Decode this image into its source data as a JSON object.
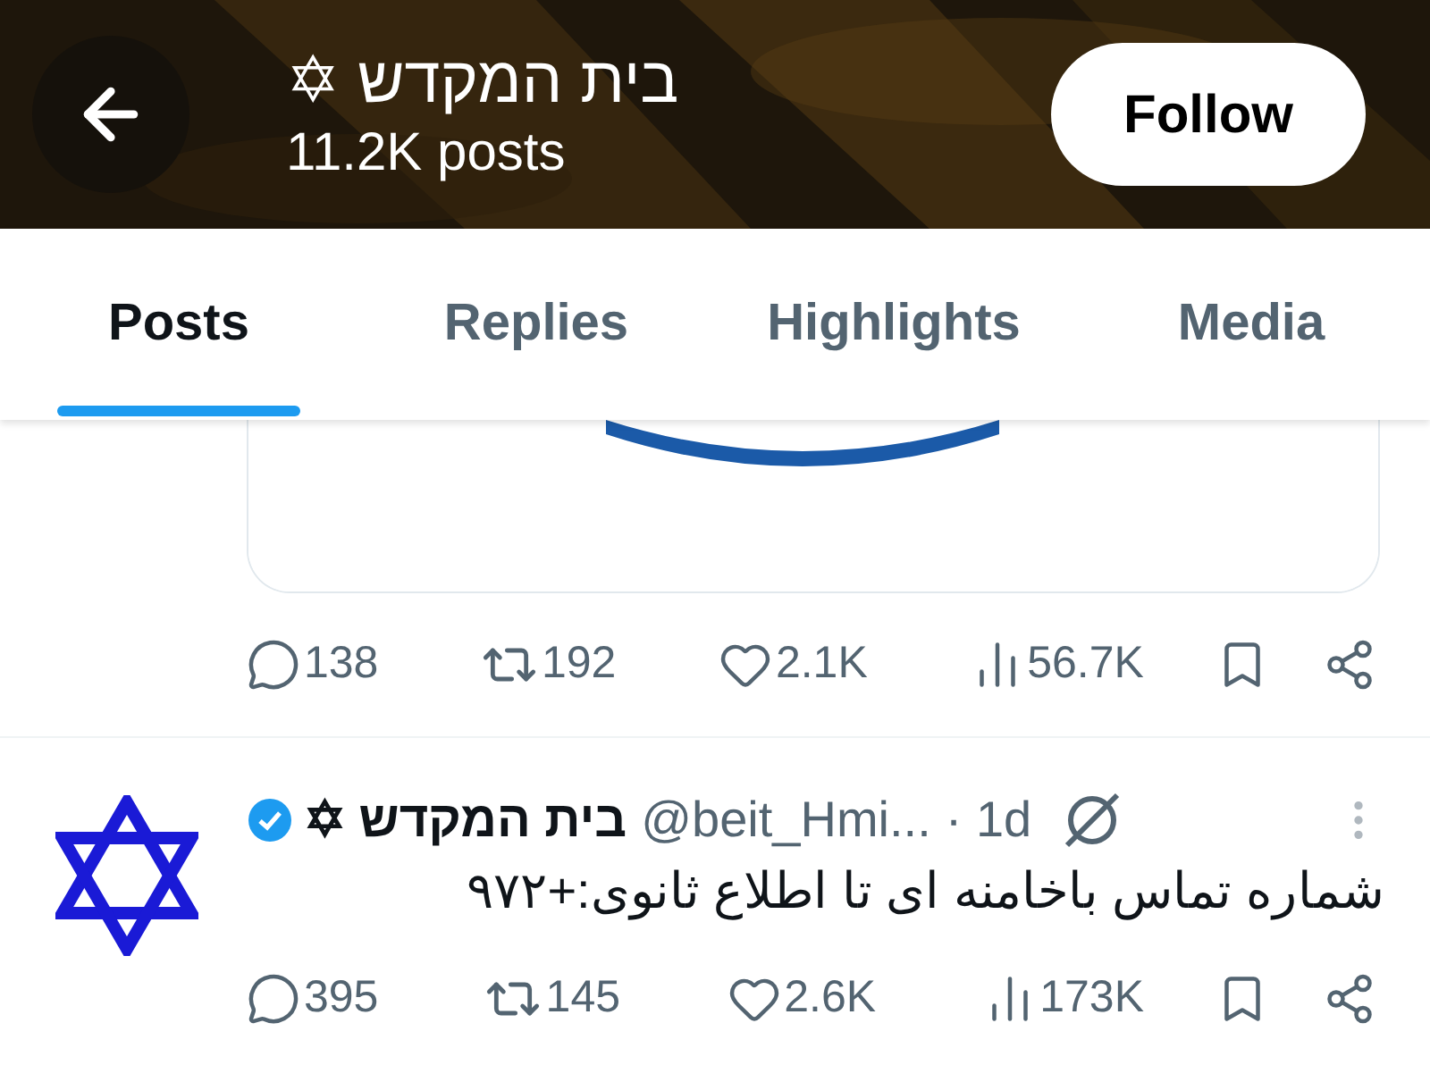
{
  "header": {
    "title": "בית המקדש ✡",
    "subtitle": "11.2K posts",
    "follow_button": "Follow"
  },
  "tabs": [
    {
      "label": "Posts",
      "selected": true
    },
    {
      "label": "Replies",
      "selected": false
    },
    {
      "label": "Highlights",
      "selected": false
    },
    {
      "label": "Media",
      "selected": false
    }
  ],
  "posts": [
    {
      "kind": "media-tail",
      "stats": [
        {
          "kind": "reply",
          "value": "138"
        },
        {
          "kind": "repost",
          "value": "192"
        },
        {
          "kind": "like",
          "value": "2.1K"
        },
        {
          "kind": "views",
          "value": "56.7K"
        }
      ]
    },
    {
      "kind": "full",
      "name": "בית המקדש ✡",
      "verified": true,
      "handle": "@beit_Hmi...",
      "time": "· 1d",
      "text": "شماره تماس باخامنه ای تا اطلاع ثانوی:+۹۷۲",
      "stats": [
        {
          "kind": "reply",
          "value": "395"
        },
        {
          "kind": "repost",
          "value": "145"
        },
        {
          "kind": "like",
          "value": "2.6K"
        },
        {
          "kind": "views",
          "value": "173K"
        }
      ]
    }
  ]
}
